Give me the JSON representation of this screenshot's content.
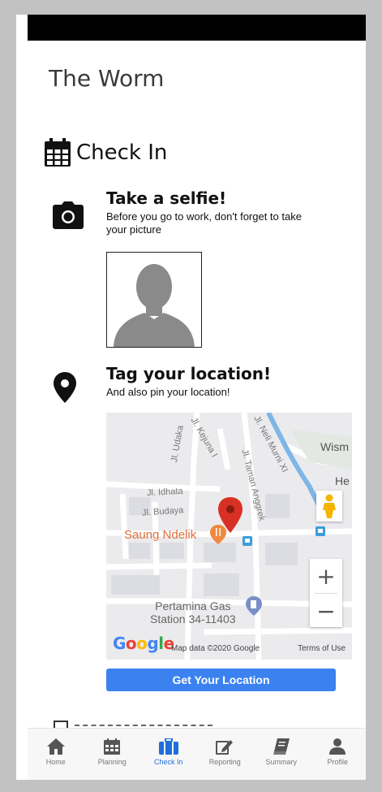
{
  "app": {
    "title": "The Worm"
  },
  "checkin": {
    "title": "Check In"
  },
  "selfie": {
    "title": "Take a selfie!",
    "description": "Before you go to work, don't forget to take your picture"
  },
  "location": {
    "title": "Tag your location!",
    "description": "And also pin your location!",
    "button_label": "Get Your Location"
  },
  "map": {
    "streets": [
      "Jl. Idhata",
      "Jl. Budaya",
      "Jl. Udaka",
      "Jl. Taman Anggrek",
      "Jl. Neli Murni XI",
      "Jl. Kejuna I"
    ],
    "places": {
      "poi": "Saung Ndelik",
      "gas_line1": "Pertamina Gas",
      "gas_line2": "Station 34-11403"
    },
    "edge_labels": [
      "Wism",
      "He"
    ],
    "google_logo": "Google",
    "attribution": "Map data ©2020 Google",
    "terms": "Terms of Use",
    "zoom_in": "+",
    "zoom_out": "−"
  },
  "nav": {
    "items": [
      {
        "label": "Home",
        "icon": "home-icon"
      },
      {
        "label": "Planning",
        "icon": "calendar-icon"
      },
      {
        "label": "Check In",
        "icon": "briefcase-icon"
      },
      {
        "label": "Reporting",
        "icon": "edit-icon"
      },
      {
        "label": "Summary",
        "icon": "book-icon"
      },
      {
        "label": "Profile",
        "icon": "user-icon"
      }
    ],
    "active_index": 2
  },
  "colors": {
    "accent": "#3b82f0",
    "active_nav": "#1e6fd9",
    "map_pin": "#d93025",
    "poi": "#e0703a"
  }
}
